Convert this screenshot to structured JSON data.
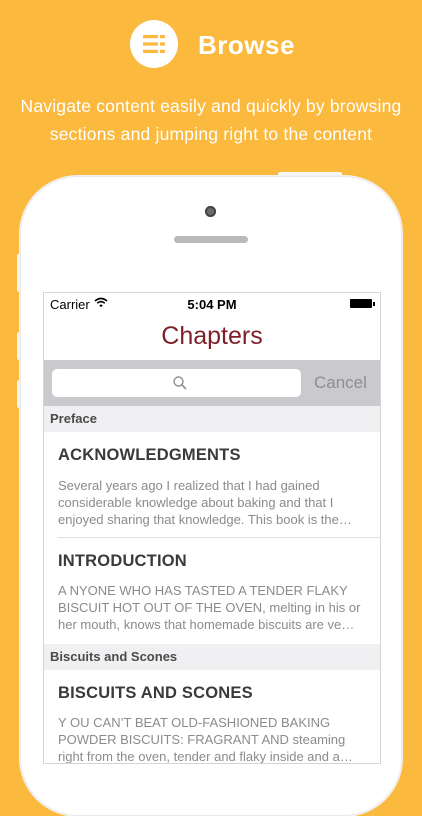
{
  "header": {
    "title": "Browse",
    "icon": "list-icon",
    "subtitle_line1": "Navigate content easily and quickly by browsing",
    "subtitle_line2": "sections and jumping right to the content"
  },
  "colors": {
    "background": "#FBB93E",
    "nav_title": "#7E1F27",
    "search_bar": "#C9C9CE"
  },
  "status_bar": {
    "carrier": "Carrier",
    "time": "5:04 PM"
  },
  "nav": {
    "title": "Chapters"
  },
  "search": {
    "placeholder": "",
    "cancel_label": "Cancel"
  },
  "sections": [
    {
      "header": "Preface",
      "rows": [
        {
          "title": "ACKNOWLEDGMENTS",
          "description": "Several years ago I realized that I had gained considerable knowledge about baking and that I enjoyed sharing that knowledge. This book is the…"
        },
        {
          "title": "INTRODUCTION",
          "description": "A NYONE WHO HAS TASTED A TENDER FLAKY BISCUIT HOT OUT OF THE OVEN, melting in his or her mouth, knows that homemade biscuits are ve…"
        }
      ]
    },
    {
      "header": "Biscuits and Scones",
      "rows": [
        {
          "title": "BISCUITS AND SCONES",
          "description": "Y OU CAN’T BEAT OLD-FASHIONED BAKING POWDER BISCUITS: FRAGRANT AND steaming right from the oven, tender and flaky inside and a…"
        }
      ]
    }
  ]
}
